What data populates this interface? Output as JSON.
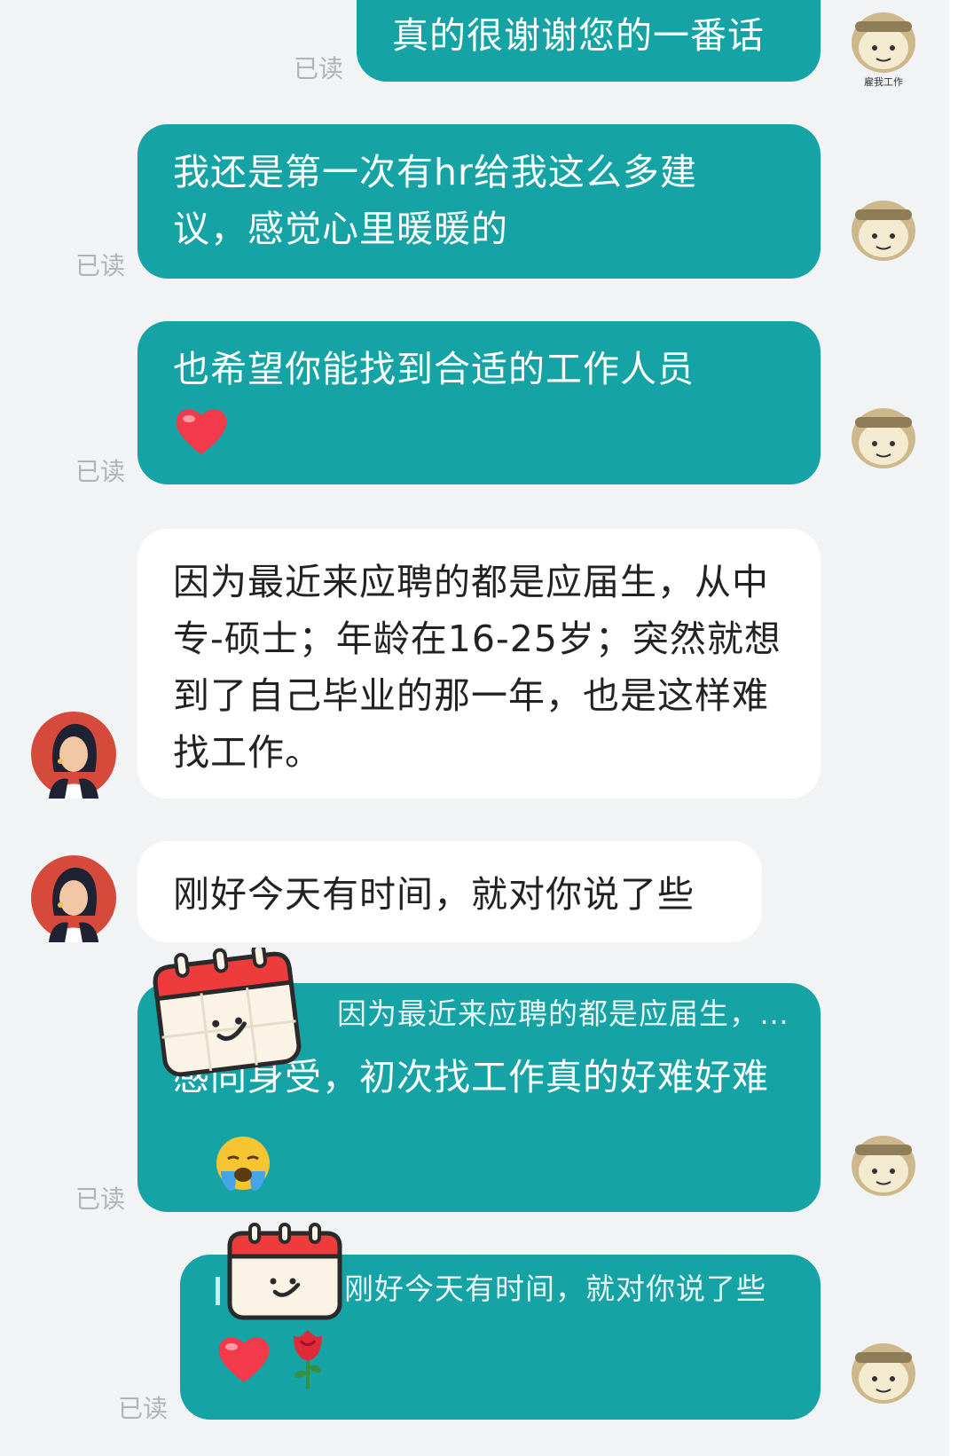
{
  "read_label": "已读",
  "messages": [
    {
      "side": "me",
      "text": "真的很谢谢您的一番话"
    },
    {
      "side": "me",
      "text": "我还是第一次有hr给我这么多建议，感觉心里暖暖的"
    },
    {
      "side": "me",
      "text": "也希望你能找到合适的工作人员",
      "emoji": "heart-emoji"
    },
    {
      "side": "them",
      "text": "因为最近来应聘的都是应届生，从中专-硕士；年龄在16-25岁；突然就想到了自己毕业的那一年，也是这样难找工作。"
    },
    {
      "side": "them",
      "text": "刚好今天有时间，就对你说了些"
    },
    {
      "side": "me",
      "quote": "因为最近来应聘的都是应届生，…",
      "text": "感同身受，初次找工作真的好难好难",
      "emoji": "crying-face-emoji"
    },
    {
      "side": "me",
      "quote": "刚好今天有时间，就对你说了些",
      "emojis": [
        "heart-emoji",
        "rose-emoji"
      ]
    }
  ],
  "colors": {
    "my_bubble": "#16a3a6",
    "their_bubble": "#ffffff",
    "background": "#f2f3f5",
    "read_text": "#b0b3b8"
  },
  "avatars": {
    "me": "cartoon-character-avatar",
    "them": "woman-portrait-avatar"
  },
  "stickers": [
    "smiling-calendar-sticker"
  ]
}
